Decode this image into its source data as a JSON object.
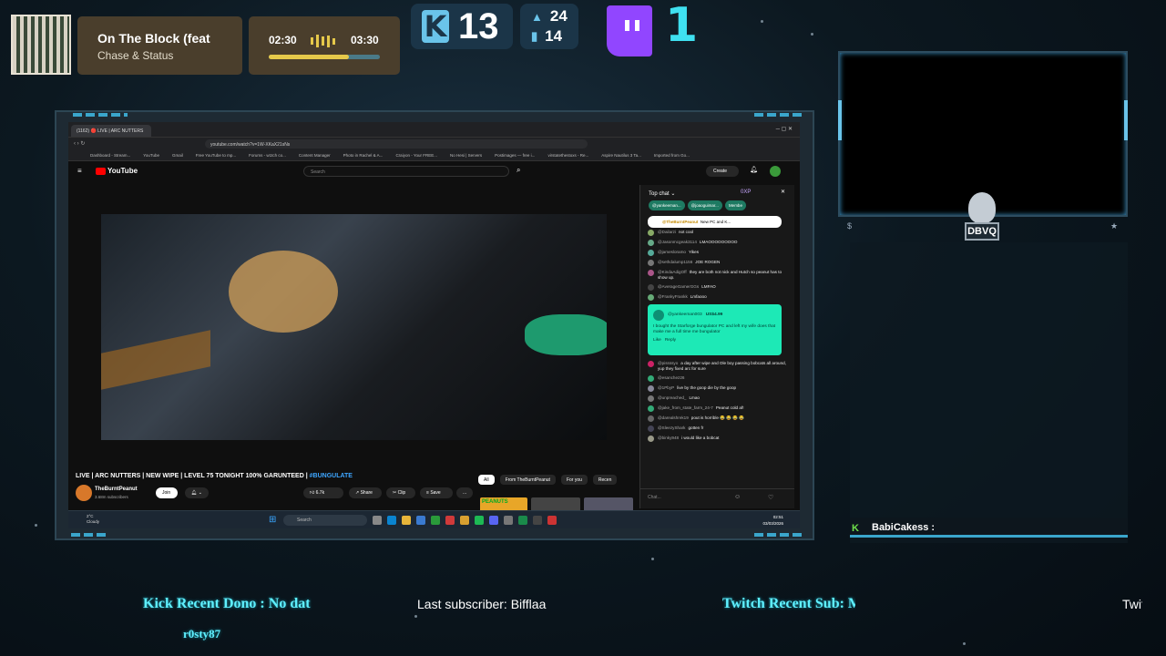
{
  "now_playing": {
    "title": "On The Block (feat",
    "artist": "Chase & Status",
    "elapsed": "02:30",
    "duration": "03:30",
    "progress": 0.72
  },
  "kick_followers": {
    "icon": "kick-logo-icon",
    "count": "13"
  },
  "ranks": {
    "top": "24",
    "bottom": "14"
  },
  "twitch": {
    "icon": "twitch-logo-icon",
    "count": "1"
  },
  "browser": {
    "tab_title": "(1162) 🔴 LIVE | ARC NUTTERS",
    "url": "youtube.com/watch?v=1W-XKaX21sNs",
    "bookmarks": [
      "Dashboard - Stream...",
      "YouTube",
      "Gmail",
      "Free YouTube to mp...",
      "Forums - w1tch co...",
      "Content Manager",
      "Photo in Rachel & A...",
      "Craiyon - Your FREE...",
      "No Hesi | Servers",
      "Postimages — free i...",
      "virstatethestoxs - Re...",
      "Aspire Nautilus 3 Ta...",
      "Imported from Go..."
    ]
  },
  "youtube": {
    "logo": "YouTube",
    "search_placeholder": "Search",
    "create": "Create",
    "notifications": "9+",
    "video_title": "LIVE | ARC NUTTERS | NEW WIPE | LEVEL 75 TONIGHT 100% GARUNTEED |",
    "video_hashtag": "#BUNGULATE",
    "channel": "TheBurntPeanut",
    "subscribers": "3.68m subscribers",
    "join": "Join",
    "likes": "6.7k",
    "share": "Share",
    "clip": "Clip",
    "save": "Save",
    "more": "...",
    "chips": [
      "All",
      "From TheBurntPeanut",
      "For you",
      "Recen"
    ],
    "thumb_label": "PEANUTS"
  },
  "chat": {
    "header": "Top chat",
    "points": "0XP",
    "pinned_users": [
      "@yankeeman...",
      "@joaoguimar...",
      "Membe"
    ],
    "pinned_msg": {
      "user": "@TheBurntPeanut",
      "text": "New PC and K..."
    },
    "messages": [
      {
        "user": "@Dailarzi",
        "text": "not cool",
        "color": "#8a6"
      },
      {
        "user": "@Jasonmcgeak3114",
        "text": "LMAOOOOOOOOO",
        "color": "#6a8"
      },
      {
        "user": "@jamesloramo",
        "text": "Yikes",
        "color": "#5a9"
      },
      {
        "user": "@sethdalump1156",
        "text": "JOE ROGEN",
        "color": "#777"
      },
      {
        "user": "@KindaAdigOff",
        "text": "they are both not nick and Hutch so peanut has to show up.",
        "color": "#a58"
      },
      {
        "user": "@AverageGamerGGs",
        "text": "LMFAO",
        "color": "#444"
      },
      {
        "user": "@FrankyFrankk",
        "text": "Lmfaooo",
        "color": "#6a7"
      }
    ],
    "superchat": {
      "user": "@yankeeman003",
      "amount": "US$4.99",
      "text": "I bought the Starforge bungulator PC and left my wife does that make me a full time me bungulator",
      "like": "Like",
      "reply": "Reply"
    },
    "messages2": [
      {
        "user": "@pissssyo",
        "text": "a day after wipe and Ole boy passing bobcats all around, yup they fixed arc for sure",
        "color": "#c26"
      },
      {
        "user": "@esanchez26",
        "text": "",
        "color": "#3a7"
      },
      {
        "user": "@1PbyP",
        "text": "live by the goop die by the goop",
        "color": "#889"
      },
      {
        "user": "@unpreached_",
        "text": "Lmao",
        "color": "#777"
      },
      {
        "user": "@jake_from_state_farm_24-7",
        "text": "Peanut cold af!",
        "color": "#3a7"
      },
      {
        "user": "@darealshrek19",
        "text": "pout is horrible 😂 😂 😂 😂",
        "color": "#666"
      },
      {
        "user": "@SleezyShark",
        "text": "gotten fr",
        "color": "#445"
      },
      {
        "user": "@binky948",
        "text": "i would like a bobcat",
        "color": "#998"
      }
    ],
    "input_placeholder": "Chat..."
  },
  "taskbar": {
    "weather": "2°C",
    "weather_desc": "Cloudy",
    "search": "Search",
    "time": "02:51",
    "date": "03/03/2026"
  },
  "camera_logo": "DBVQ",
  "recent_chat": {
    "name": "BabiCakess :"
  },
  "tickers": {
    "kick_dono": "Kick Recent Dono : No dat",
    "last_sub": "Last subscriber: Bifflaa",
    "twitch_sub": "Twitch Recent Sub: Mista",
    "twitch_cut": "Twitc",
    "donor": "r0sty87"
  },
  "colors": {
    "accent": "#3aa6cc",
    "gold": "#e6c94a",
    "twitch": "#9146ff",
    "ticker": "#5ff0ff"
  }
}
